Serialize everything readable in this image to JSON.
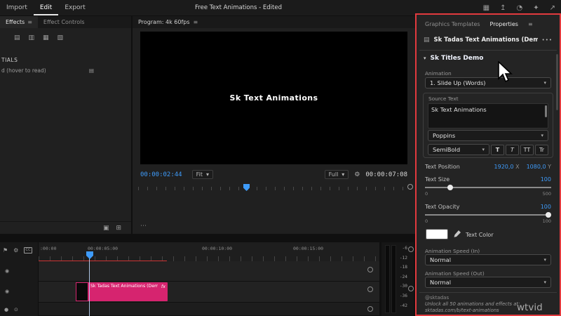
{
  "topbar": {
    "menu": [
      "Import",
      "Edit",
      "Export"
    ],
    "title": "Free Text Animations - Edited"
  },
  "icons": {
    "menu": "≡",
    "chevron": "▾",
    "dots": "•••",
    "ellipsis": "⋯",
    "flag": "⚑",
    "wrench": "⚙",
    "cc": "CC",
    "eye": "◉",
    "mute": "●",
    "mic": "⊙",
    "folder": "▣",
    "new_item": "⊞",
    "workspace": "▦",
    "quick_export": "↥",
    "progress": "◔",
    "ai": "✦",
    "maximize": "↗",
    "clip_thumb": "▤",
    "bins": [
      "▤",
      "▥",
      "▦",
      "▧"
    ]
  },
  "effects_panel": {
    "tabs": [
      "Effects",
      "Effect Controls"
    ],
    "sidebar_label": "TIALS",
    "hover_note": "d (hover to read)"
  },
  "program": {
    "title": "Program: 4k 60fps",
    "preview_text": "Sk Text Animations",
    "current_time": "00:00:02:44",
    "fit": "Fit",
    "zoom": "Full",
    "duration": "00:00:07:08"
  },
  "properties": {
    "tabs": [
      "Graphics Templates",
      "Properties"
    ],
    "clip_title": "Sk Tadas Text Animations (Demo)",
    "section_title": "Sk Titles Demo",
    "animation": {
      "label": "Animation",
      "value": "1. Slide Up (Words)"
    },
    "source_text": {
      "label": "Source Text",
      "value": "Sk Text Animations"
    },
    "font": {
      "family": "Poppins",
      "style": "SemiBold",
      "style_buttons": [
        "T",
        "T",
        "TT",
        "Tr"
      ]
    },
    "position": {
      "label": "Text Position",
      "x_value": "1920,0",
      "x_axis": "X",
      "y_value": "1080,0",
      "y_axis": "Y"
    },
    "size": {
      "label": "Text Size",
      "value": "100",
      "min": "0",
      "max": "500"
    },
    "opacity": {
      "label": "Text Opacity",
      "value": "100",
      "min": "0",
      "max": "100"
    },
    "color": {
      "label": "Text Color"
    },
    "speed_in": {
      "label": "Animation Speed (In)",
      "value": "Normal"
    },
    "speed_out": {
      "label": "Animation Speed (Out)",
      "value": "Normal"
    },
    "promo": {
      "handle": "@sktadas",
      "text": "Unlock all 50 animations and effects at: sktadas.com/b/text-animations"
    }
  },
  "timeline": {
    "ruler": [
      ":00:00",
      "00:00:05:00",
      "00:00:10:00",
      "00:00:15:00"
    ],
    "clip": {
      "name": "Sk Tadas Text Animations (Demo)",
      "badge": "fx"
    }
  },
  "audio_meter": {
    "db": [
      "-6",
      "-12",
      "-18",
      "-24",
      "-30",
      "-36",
      "-42"
    ]
  },
  "watermark": "wtvid"
}
